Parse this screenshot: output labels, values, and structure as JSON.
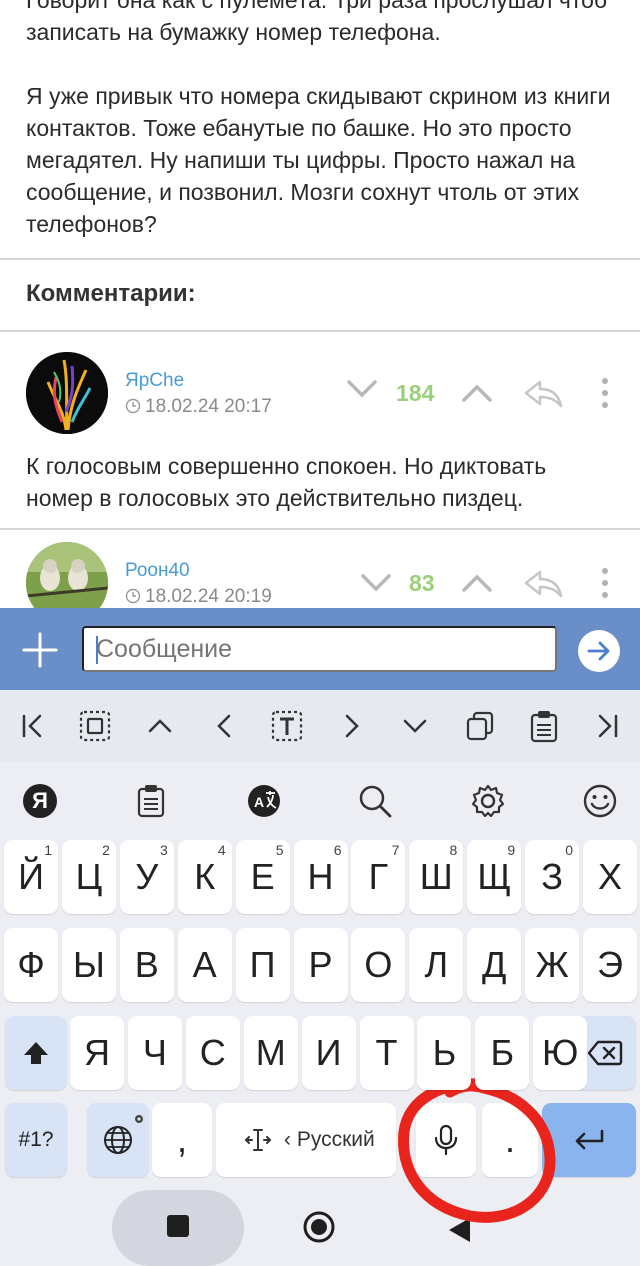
{
  "post": {
    "paragraph_1": "Говорит она как с пулемёта. Три раза прослушал чтоб записать на бумажку номер телефона.",
    "paragraph_2": "Я уже привык что номера скидывают скрином из книги контактов. Тоже ебанутые по башке. Но это просто мегадятел. Ну напиши ты цифры. Просто нажал на сообщение, и позвонил. Мозги сохнут чтоль от этих телефонов?"
  },
  "comments_header": "Комментарии:",
  "comments": [
    {
      "author": "ЯрChe",
      "date": "18.02.24 20:17",
      "score": "184",
      "text": "К голосовым совершенно спокоен. Но диктовать номер в голосовых это действительно пиздец."
    },
    {
      "author": "Роон40",
      "date": "18.02.24 20:19",
      "score": "83"
    }
  ],
  "message_bar": {
    "placeholder": "Сообщение"
  },
  "keyboard": {
    "row1": [
      {
        "label": "Й",
        "hint": "1"
      },
      {
        "label": "Ц",
        "hint": "2"
      },
      {
        "label": "У",
        "hint": "3"
      },
      {
        "label": "К",
        "hint": "4"
      },
      {
        "label": "Е",
        "hint": "5"
      },
      {
        "label": "Н",
        "hint": "6"
      },
      {
        "label": "Г",
        "hint": "7"
      },
      {
        "label": "Ш",
        "hint": "8"
      },
      {
        "label": "Щ",
        "hint": "9"
      },
      {
        "label": "З",
        "hint": "0"
      },
      {
        "label": "Х",
        "hint": ""
      }
    ],
    "row2": [
      "Ф",
      "Ы",
      "В",
      "А",
      "П",
      "Р",
      "О",
      "Л",
      "Д",
      "Ж",
      "Э"
    ],
    "row3": [
      "Я",
      "Ч",
      "С",
      "М",
      "И",
      "Т",
      "Ь",
      "Б",
      "Ю"
    ],
    "symbols_label": "#1?",
    "comma_label": ",",
    "period_label": ".",
    "language_label": "‹ Русский",
    "yandex_label": "Я"
  },
  "colors": {
    "accent_blue": "#6a8fc8",
    "author_blue": "#4a9bd4",
    "score_green": "#9bd07a",
    "annotation_red": "#e8241c"
  },
  "icons": [
    "plus-icon",
    "send-arrow-icon",
    "clock-icon",
    "chevron-down-icon",
    "chevron-up-icon",
    "reply-arrow-icon",
    "more-vertical-icon",
    "microphone-icon",
    "globe-icon",
    "backspace-icon",
    "shift-icon",
    "enter-icon",
    "cursor-move-icon",
    "search-icon",
    "gear-icon",
    "smiley-icon",
    "clipboard-icon",
    "translate-icon"
  ]
}
